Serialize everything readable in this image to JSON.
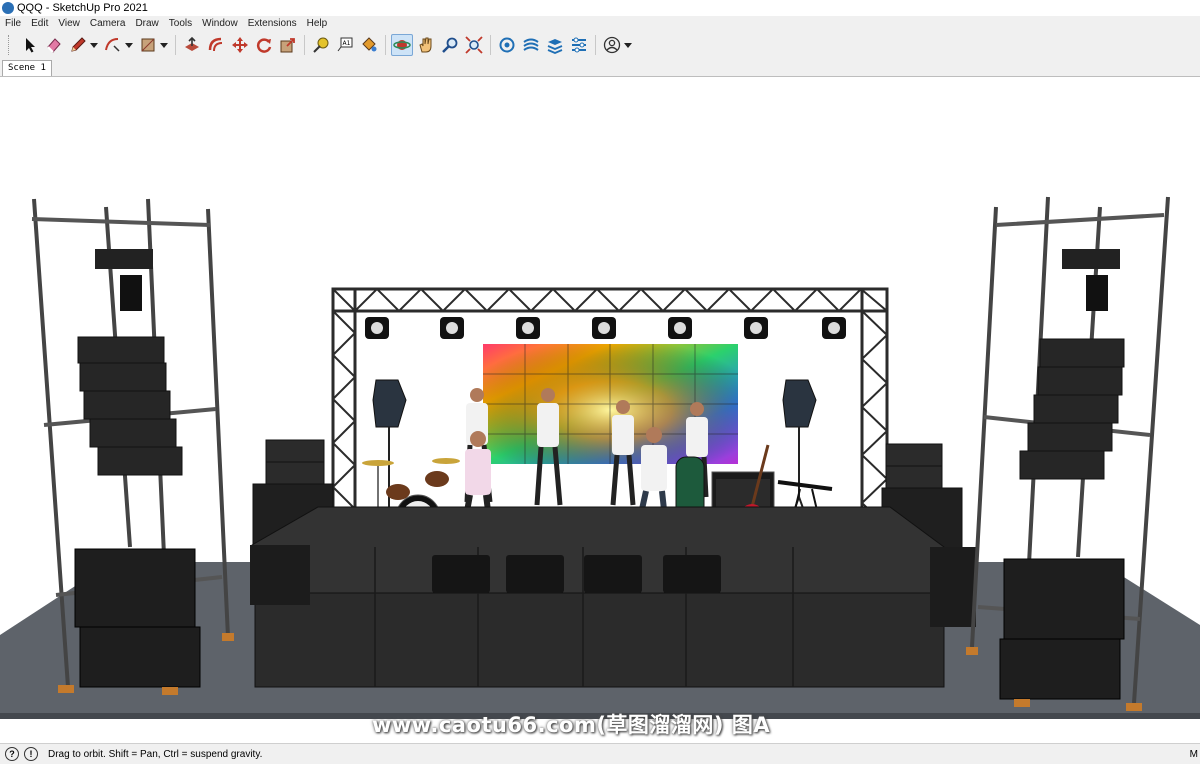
{
  "window": {
    "title": "QQQ - SketchUp Pro 2021"
  },
  "menu": [
    "File",
    "Edit",
    "View",
    "Camera",
    "Draw",
    "Tools",
    "Window",
    "Extensions",
    "Help"
  ],
  "toolbar": {
    "tools": [
      {
        "name": "select-tool-button",
        "icon": "arrow-cursor-icon"
      },
      {
        "name": "eraser-tool-button",
        "icon": "eraser-icon"
      },
      {
        "name": "line-tool-button",
        "icon": "pencil-icon",
        "dropdown": true
      },
      {
        "name": "arc-tool-button",
        "icon": "arc-icon",
        "dropdown": true
      },
      {
        "name": "rectangle-tool-button",
        "icon": "rectangle-icon",
        "dropdown": true
      },
      {
        "name": "push-pull-tool-button",
        "icon": "push-pull-icon"
      },
      {
        "name": "offset-tool-button",
        "icon": "offset-icon"
      },
      {
        "name": "move-tool-button",
        "icon": "move-arrows-icon"
      },
      {
        "name": "rotate-tool-button",
        "icon": "rotate-icon"
      },
      {
        "name": "scale-tool-button",
        "icon": "scale-icon"
      },
      {
        "name": "tape-measure-tool-button",
        "icon": "tape-measure-icon"
      },
      {
        "name": "text-tool-button",
        "icon": "text-icon"
      },
      {
        "name": "paint-bucket-tool-button",
        "icon": "paint-bucket-icon"
      },
      {
        "name": "orbit-tool-button",
        "icon": "orbit-icon",
        "active": true
      },
      {
        "name": "pan-tool-button",
        "icon": "pan-hand-icon"
      },
      {
        "name": "zoom-tool-button",
        "icon": "zoom-icon"
      },
      {
        "name": "zoom-extents-tool-button",
        "icon": "zoom-extents-icon"
      },
      {
        "name": "warehouse-button",
        "icon": "warehouse-icon"
      },
      {
        "name": "extension-warehouse-button",
        "icon": "extension-warehouse-icon"
      },
      {
        "name": "layout-button",
        "icon": "layout-icon"
      },
      {
        "name": "extension-manager-button",
        "icon": "extension-manager-icon"
      },
      {
        "name": "account-button",
        "icon": "account-icon",
        "dropdown": true
      }
    ]
  },
  "scenes": {
    "tabs": [
      "Scene 1"
    ]
  },
  "watermark": "www.caotu66.com(草图溜溜网) 图A",
  "status": {
    "icons": [
      "geo-location-icon",
      "info-icon"
    ],
    "text": "Drag to orbit. Shift = Pan, Ctrl = suspend gravity.",
    "measurements_label": "M"
  },
  "colors": {
    "stage": "#3a3a3a",
    "floor": "#5e636a",
    "truss": "#2b2b2b",
    "accent": "#c47a2c"
  }
}
